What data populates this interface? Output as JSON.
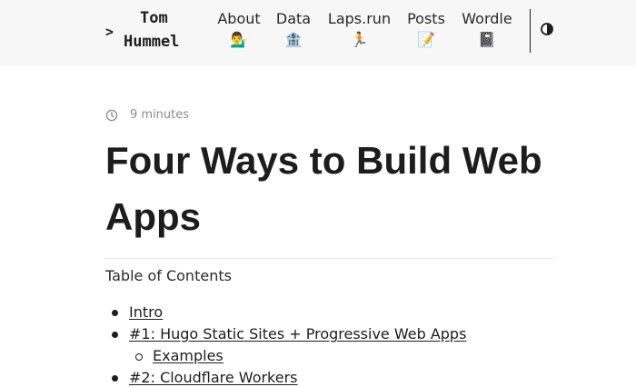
{
  "header": {
    "logo": {
      "prompt": ">",
      "first_name": "Tom",
      "last_name": "Hummel"
    },
    "nav": [
      {
        "label": "About",
        "emoji": "💁‍♂️",
        "icon_name": "person-tipping-hand-icon"
      },
      {
        "label": "Data",
        "emoji": "🏦",
        "icon_name": "bank-icon"
      },
      {
        "label": "Laps.run",
        "emoji": "🏃",
        "icon_name": "runner-icon"
      },
      {
        "label": "Posts",
        "emoji": "📝",
        "icon_name": "memo-icon"
      },
      {
        "label": "Wordle",
        "emoji": "📓",
        "icon_name": "notebook-icon"
      }
    ],
    "theme_toggle_icon": "half-circle-contrast-icon"
  },
  "post": {
    "reading_time": "9 minutes",
    "title": "Four Ways to Build Web Apps"
  },
  "toc": {
    "heading": "Table of Contents",
    "items": [
      {
        "label": "Intro",
        "level": 1
      },
      {
        "label": "#1: Hugo Static Sites + Progressive Web Apps",
        "level": 1
      },
      {
        "label": "Examples",
        "level": 2
      },
      {
        "label": "#2: Cloudflare Workers",
        "level": 1
      }
    ]
  },
  "colors": {
    "header_background": "#f7f7f7",
    "text": "#1d1d1d",
    "muted": "#8a8a8a"
  }
}
